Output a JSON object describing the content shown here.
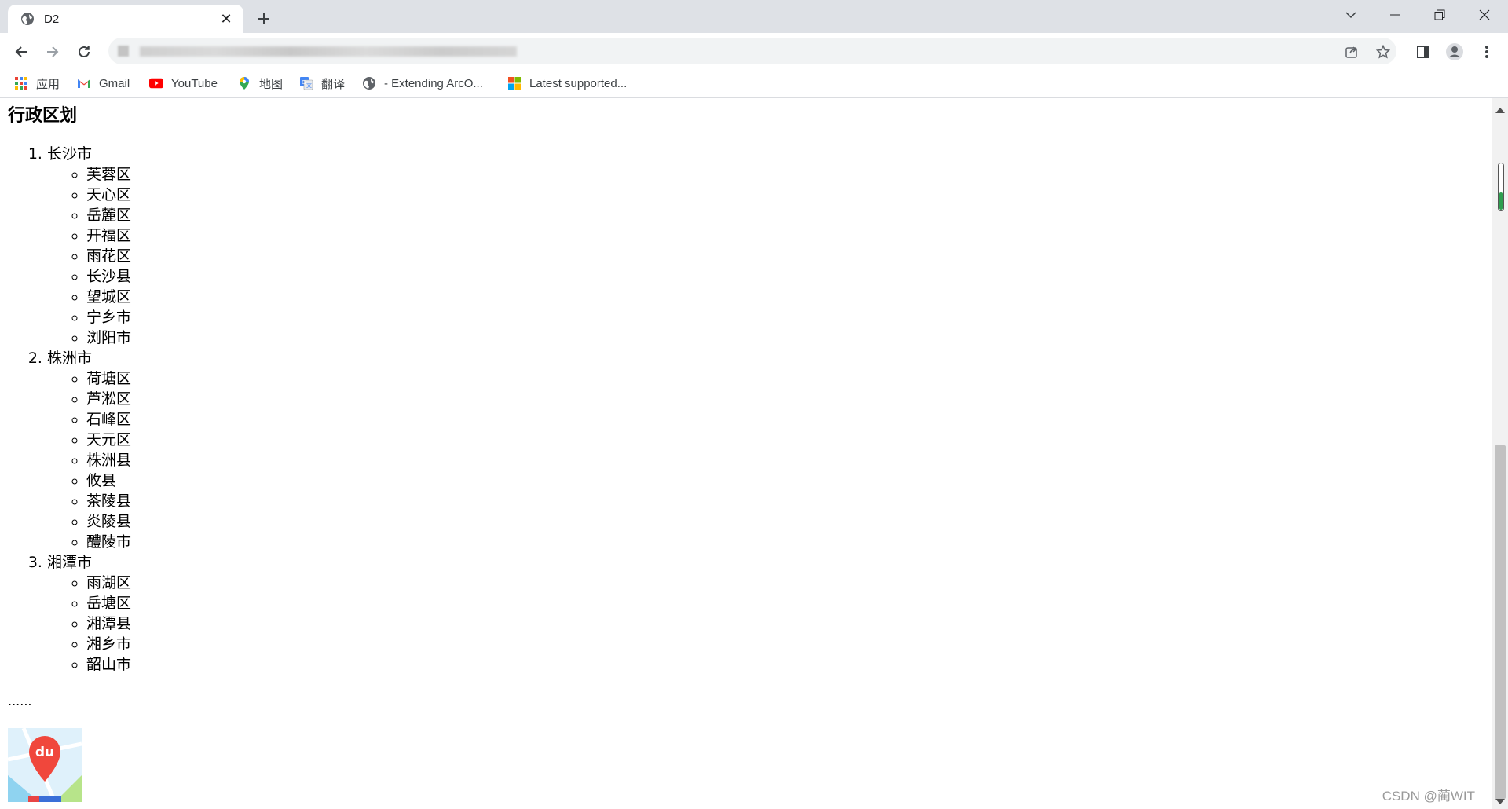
{
  "browser": {
    "tab": {
      "title": "D2",
      "favicon": "globe-icon"
    },
    "new_tab_icon": "plus-icon",
    "window_controls": [
      "tab-search-icon",
      "minimize-icon",
      "restore-icon",
      "close-icon"
    ],
    "nav": [
      "back-icon",
      "forward-icon",
      "reload-icon"
    ],
    "omnibox_icons": [
      "share-icon",
      "star-icon"
    ],
    "toolbar_icons": [
      "side-panel-icon",
      "profile-icon",
      "menu-icon"
    ]
  },
  "bookmarks": [
    {
      "label": "应用",
      "icon": "apps-grid-icon"
    },
    {
      "label": "Gmail",
      "icon": "gmail-icon"
    },
    {
      "label": "YouTube",
      "icon": "youtube-icon"
    },
    {
      "label": "地图",
      "icon": "maps-pin-icon"
    },
    {
      "label": "翻译",
      "icon": "translate-icon"
    },
    {
      "label": "- Extending ArcO...",
      "icon": "globe-icon"
    },
    {
      "label": "Latest supported...",
      "icon": "windows-logo-icon"
    }
  ],
  "page": {
    "title": "行政区划",
    "cities": [
      {
        "name": "长沙市",
        "districts": [
          "芙蓉区",
          "天心区",
          "岳麓区",
          "开福区",
          "雨花区",
          "长沙县",
          "望城区",
          "宁乡市",
          "浏阳市"
        ]
      },
      {
        "name": "株洲市",
        "districts": [
          "荷塘区",
          "芦淞区",
          "石峰区",
          "天元区",
          "株洲县",
          "攸县",
          "茶陵县",
          "炎陵县",
          "醴陵市"
        ]
      },
      {
        "name": "湘潭市",
        "districts": [
          "雨湖区",
          "岳塘区",
          "湘潭县",
          "湘乡市",
          "韶山市"
        ]
      }
    ],
    "ellipsis": "......",
    "map_logo_text": "du",
    "watermark": "CSDN @蔺WIT"
  }
}
